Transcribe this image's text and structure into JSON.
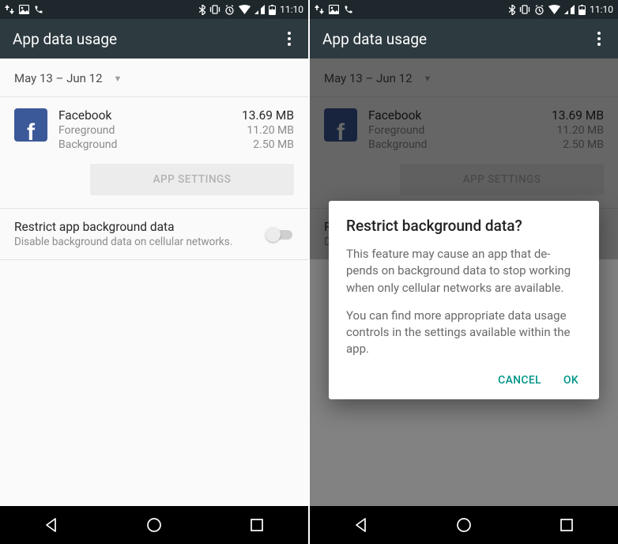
{
  "statusbar": {
    "time": "11:10"
  },
  "appbar": {
    "title": "App data usage"
  },
  "date_range": "May 13 – Jun 12",
  "app": {
    "name": "Facebook",
    "total": "13.69 MB",
    "foreground_label": "Foreground",
    "foreground_value": "11.20 MB",
    "background_label": "Background",
    "background_value": "2.50 MB"
  },
  "buttons": {
    "app_settings": "APP SETTINGS"
  },
  "restrict": {
    "title": "Restrict app background data",
    "subtitle": "Disable background data on cellular networks."
  },
  "dialog": {
    "title": "Restrict background data?",
    "body1": "This feature may cause an app that de-pends on background data to stop working when only cellular networks are available.",
    "body2": "You can find more appropriate data usage controls in the settings available within the app.",
    "cancel": "CANCEL",
    "ok": "OK"
  }
}
